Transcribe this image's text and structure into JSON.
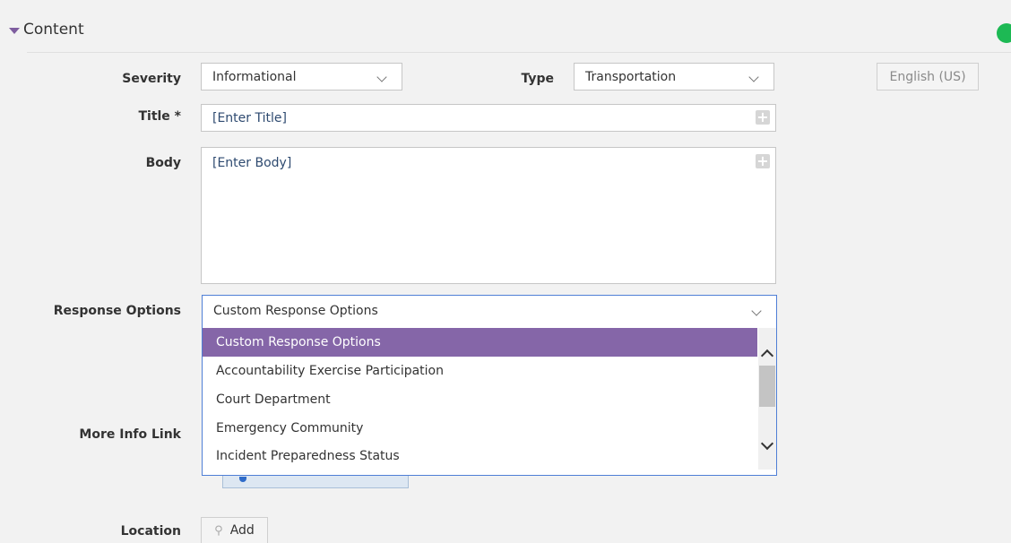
{
  "section": {
    "title": "Content"
  },
  "language_button": "English (US)",
  "severity": {
    "label": "Severity",
    "value": "Informational"
  },
  "type": {
    "label": "Type",
    "value": "Transportation"
  },
  "title_field": {
    "label": "Title *",
    "placeholder": "[Enter Title]"
  },
  "body_field": {
    "label": "Body",
    "placeholder": "[Enter Body]"
  },
  "response_options": {
    "label": "Response Options",
    "value": "Custom Response Options",
    "options": [
      "Custom Response Options",
      "Accountability Exercise Participation",
      "Court Department",
      "Emergency Community",
      "Incident Preparedness Status"
    ]
  },
  "more_info": {
    "label": "More Info Link"
  },
  "location": {
    "label": "Location",
    "add_label": "Add"
  },
  "colors": {
    "accent": "#8566a8",
    "status": "#1db954",
    "focus": "#4f7fd6"
  },
  "icons": [
    "caret-down-icon",
    "chevron-down-icon",
    "plus-icon",
    "map-pin-icon",
    "scroll-up-icon",
    "scroll-down-icon"
  ]
}
